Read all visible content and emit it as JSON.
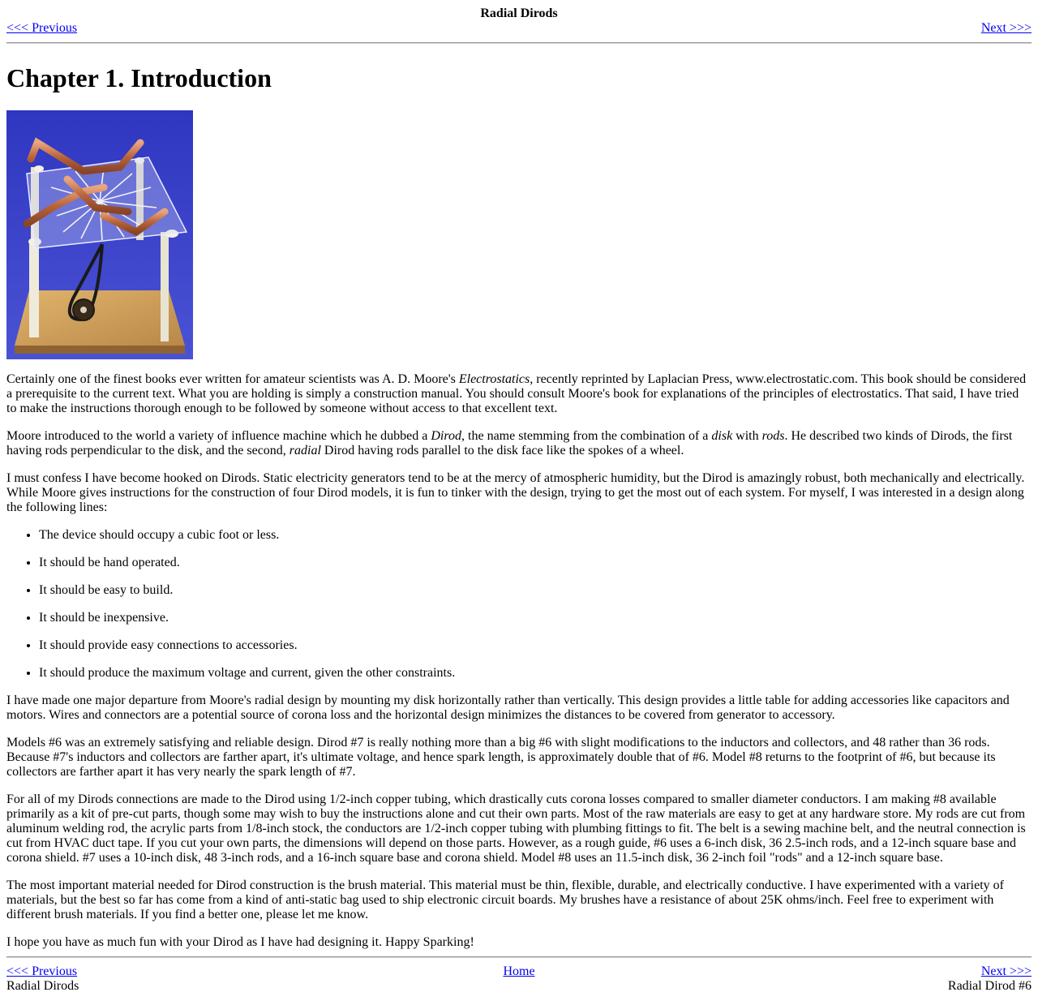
{
  "header": {
    "title": "Radial Dirods",
    "prev_label": "<<< Previous",
    "next_label": "Next >>>"
  },
  "chapter": {
    "title": "Chapter 1. Introduction",
    "photo_icon": "dirod-photo-icon"
  },
  "paragraphs": {
    "p1": {
      "a": "Certainly one of the finest books ever written for amateur scientists was A. D. Moore's ",
      "em": "Electrostatics",
      "b": ", recently reprinted by Laplacian Press, www.electrostatic.com. This book should be considered a prerequisite to the current text. What you are holding is simply a construction manual. You should consult Moore's book for explanations of the principles of electrostatics. That said, I have tried to make the instructions thorough enough to be followed by someone without access to that excellent text."
    },
    "p2": {
      "a": "Moore introduced to the world a variety of influence machine which he dubbed a ",
      "em1": "Dirod",
      "b": ", the name stemming from the combination of a ",
      "em2": "disk",
      "c": " with ",
      "em3": "rods",
      "d": ". He described two kinds of Dirods, the first having rods perpendicular to the disk, and the second, ",
      "em4": "radial",
      "e": " Dirod having rods parallel to the disk face like the spokes of a wheel."
    },
    "p3": "I must confess I have become hooked on Dirods. Static electricity generators tend to be at the mercy of atmospheric humidity, but the Dirod is amazingly robust, both mechanically and electrically. While Moore gives instructions for the construction of four Dirod models, it is fun to tinker with the design, trying to get the most out of each system. For myself, I was interested in a design along the following lines:",
    "p4": "I have made one major departure from Moore's radial design by mounting my disk horizontally rather than vertically. This design provides a little table for adding accessories like capacitors and motors. Wires and connectors are a potential source of corona loss and the horizontal design minimizes the distances to be covered from generator to accessory.",
    "p5": "Models #6 was an extremely satisfying and reliable design. Dirod #7 is really nothing more than a big #6 with slight modifications to the inductors and collectors, and 48 rather than 36 rods. Because #7's inductors and collectors are farther apart, it's ultimate voltage, and hence spark length, is approximately double that of #6. Model #8 returns to the footprint of #6, but because its collectors are farther apart it has very nearly the spark length of #7.",
    "p6": "For all of my Dirods connections are made to the Dirod using 1/2-inch copper tubing, which drastically cuts corona losses compared to smaller diameter conductors. I am making #8 available primarily as a kit of pre-cut parts, though some may wish to buy the instructions alone and cut their own parts. Most of the raw materials are easy to get at any hardware store. My rods are cut from aluminum welding rod, the acrylic parts from 1/8-inch stock, the conductors are 1/2-inch copper tubing with plumbing fittings to fit. The belt is a sewing machine belt, and the neutral connection is cut from HVAC duct tape. If you cut your own parts, the dimensions will depend on those parts. However, as a rough guide, #6 uses a 6-inch disk, 36 2.5-inch rods, and a 12-inch square base and corona shield. #7 uses a 10-inch disk, 48 3-inch rods, and a 16-inch square base and corona shield. Model #8 uses an 11.5-inch disk, 36 2-inch foil \"rods\" and a 12-inch square base.",
    "p7": "The most important material needed for Dirod construction is the brush material. This material must be thin, flexible, durable, and electrically conductive. I have experimented with a variety of materials, but the best so far has come from a kind of anti-static bag used to ship electronic circuit boards. My brushes have a resistance of about 25K ohms/inch. Feel free to experiment with different brush materials. If you find a better one, please let me know.",
    "p8": "I hope you have as much fun with your Dirod as I have had designing it. Happy Sparking!"
  },
  "requirements": [
    "The device should occupy a cubic foot or less.",
    "It should be hand operated.",
    "It should be easy to build.",
    "It should be inexpensive.",
    "It should provide easy connections to accessories.",
    "It should produce the maximum voltage and current, given the other constraints."
  ],
  "footer": {
    "prev_label": "<<< Previous",
    "home_label": "Home",
    "next_label": "Next >>>",
    "prev_title": "Radial Dirods",
    "next_title": "Radial Dirod #6"
  },
  "colors": {
    "link": "#0000ee",
    "photo_background": "#3a41c6",
    "copper": "#c8764a",
    "wood": "#c99b5a"
  }
}
